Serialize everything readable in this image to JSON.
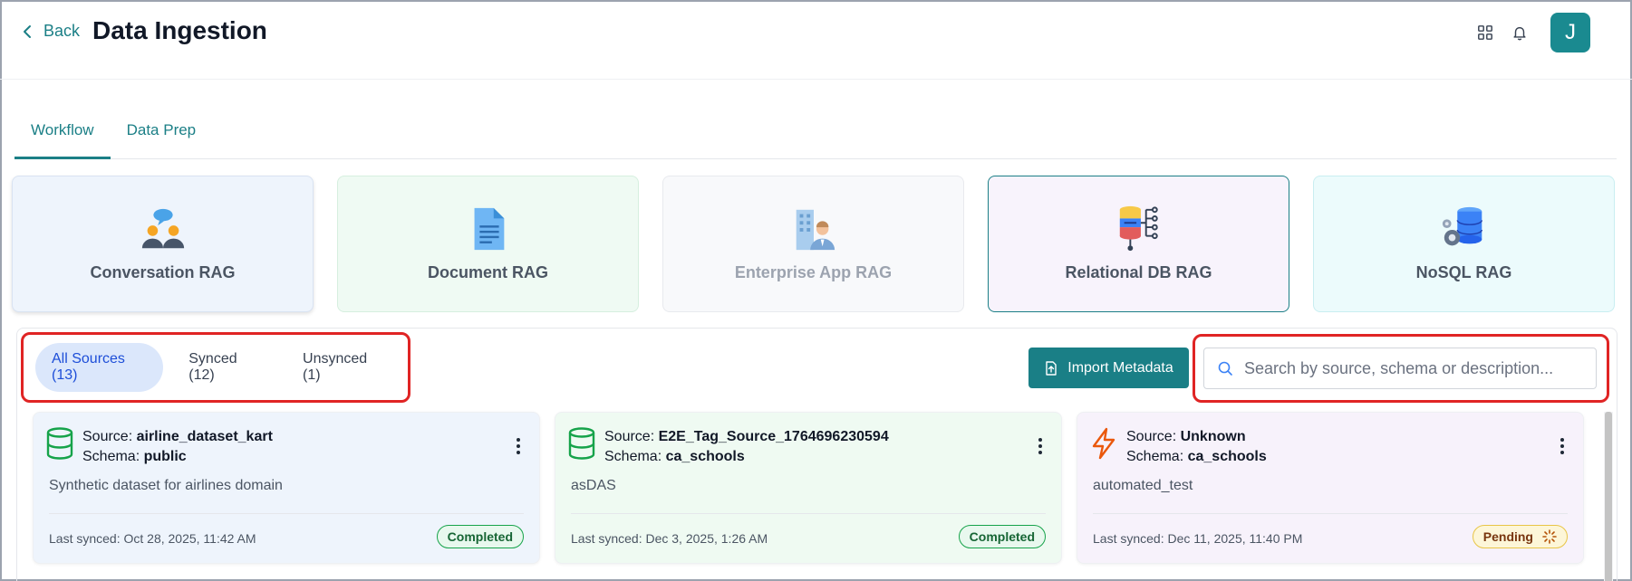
{
  "header": {
    "back_label": "Back",
    "title": "Data Ingestion",
    "avatar_initial": "J"
  },
  "tabs": [
    {
      "label": "Workflow",
      "active": true
    },
    {
      "label": "Data Prep",
      "active": false
    }
  ],
  "rag_cards": [
    {
      "label": "Conversation RAG",
      "icon": "conversation-icon"
    },
    {
      "label": "Document RAG",
      "icon": "document-icon"
    },
    {
      "label": "Enterprise App RAG",
      "icon": "enterprise-app-icon"
    },
    {
      "label": "Relational DB RAG",
      "icon": "relational-db-icon"
    },
    {
      "label": "NoSQL RAG",
      "icon": "nosql-icon"
    }
  ],
  "filters": [
    {
      "label": "All Sources (13)",
      "active": true
    },
    {
      "label": "Synced (12)",
      "active": false
    },
    {
      "label": "Unsynced (1)",
      "active": false
    }
  ],
  "import_button": {
    "label": "Import Metadata"
  },
  "search": {
    "placeholder": "Search by source, schema or description..."
  },
  "sources": [
    {
      "source_label": "Source:",
      "source": "airline_dataset_kart",
      "schema_label": "Schema:",
      "schema": "public",
      "description": "Synthetic dataset for airlines domain",
      "last_synced": "Last synced: Oct 28, 2025, 11:42 AM",
      "status": "Completed",
      "icon": "database-icon"
    },
    {
      "source_label": "Source:",
      "source": "E2E_Tag_Source_1764696230594",
      "schema_label": "Schema:",
      "schema": "ca_schools",
      "description": "asDAS",
      "last_synced": "Last synced: Dec 3, 2025, 1:26 AM",
      "status": "Completed",
      "icon": "database-icon"
    },
    {
      "source_label": "Source:",
      "source": "Unknown",
      "schema_label": "Schema:",
      "schema": "ca_schools",
      "description": "automated_test",
      "last_synced": "Last synced: Dec 11, 2025, 11:40 PM",
      "status": "Pending",
      "icon": "lightning-icon"
    }
  ],
  "colors": {
    "accent": "#1a7f86",
    "highlight_border": "#e02424",
    "completed_green": "#16a34a",
    "pending_yellow": "#e8c547"
  }
}
